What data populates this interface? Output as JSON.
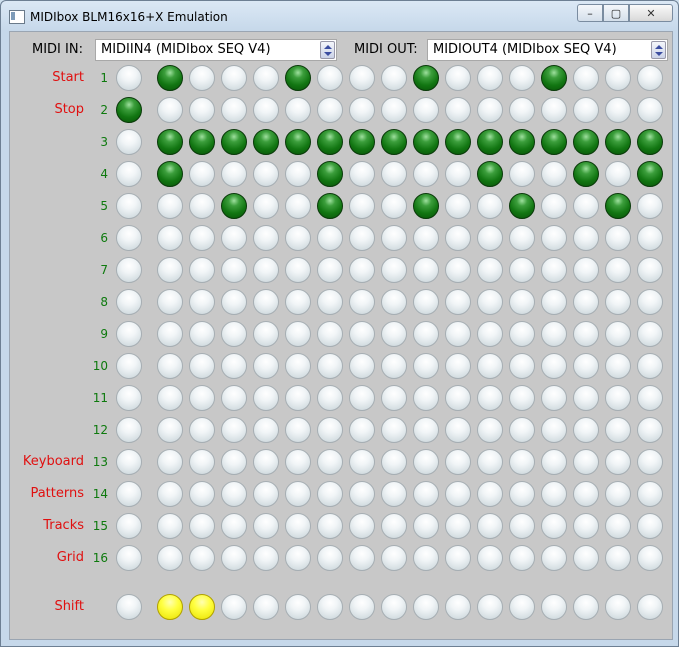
{
  "window": {
    "title": "MIDIbox BLM16x16+X Emulation",
    "min_glyph": "–",
    "max_glyph": "▢",
    "close_glyph": "✕"
  },
  "midi_in": {
    "label": "MIDI IN:",
    "value": "MIDIIN4 (MIDIbox SEQ V4)"
  },
  "midi_out": {
    "label": "MIDI OUT:",
    "value": "MIDIOUT4 (MIDIbox SEQ V4)"
  },
  "rows": [
    {
      "label": "Start",
      "num": "1"
    },
    {
      "label": "Stop",
      "num": "2"
    },
    {
      "label": "",
      "num": "3"
    },
    {
      "label": "",
      "num": "4"
    },
    {
      "label": "",
      "num": "5"
    },
    {
      "label": "",
      "num": "6"
    },
    {
      "label": "",
      "num": "7"
    },
    {
      "label": "",
      "num": "8"
    },
    {
      "label": "",
      "num": "9"
    },
    {
      "label": "",
      "num": "10"
    },
    {
      "label": "",
      "num": "11"
    },
    {
      "label": "",
      "num": "12"
    },
    {
      "label": "Keyboard",
      "num": "13"
    },
    {
      "label": "Patterns",
      "num": "14"
    },
    {
      "label": "Tracks",
      "num": "15"
    },
    {
      "label": "Grid",
      "num": "16"
    }
  ],
  "shift_row": {
    "label": "Shift",
    "num": ""
  },
  "colors": {
    "led_on": "#127612",
    "shift_on": "#ffff40",
    "label": "#e01010",
    "number": "#0e7a0e"
  },
  "extra_column_on": [
    false,
    true,
    false,
    false,
    false,
    false,
    false,
    false,
    false,
    false,
    false,
    false,
    false,
    false,
    false,
    false
  ],
  "grid_on": [
    [
      1,
      0,
      0,
      0,
      1,
      0,
      0,
      0,
      1,
      0,
      0,
      0,
      1,
      0,
      0,
      0
    ],
    [
      0,
      0,
      0,
      0,
      0,
      0,
      0,
      0,
      0,
      0,
      0,
      0,
      0,
      0,
      0,
      0
    ],
    [
      1,
      1,
      1,
      1,
      1,
      1,
      1,
      1,
      1,
      1,
      1,
      1,
      1,
      1,
      1,
      1
    ],
    [
      1,
      0,
      0,
      0,
      0,
      1,
      0,
      0,
      0,
      0,
      1,
      0,
      0,
      1,
      0,
      1
    ],
    [
      0,
      0,
      1,
      0,
      0,
      1,
      0,
      0,
      1,
      0,
      0,
      1,
      0,
      0,
      1,
      0
    ],
    [
      0,
      0,
      0,
      0,
      0,
      0,
      0,
      0,
      0,
      0,
      0,
      0,
      0,
      0,
      0,
      0
    ],
    [
      0,
      0,
      0,
      0,
      0,
      0,
      0,
      0,
      0,
      0,
      0,
      0,
      0,
      0,
      0,
      0
    ],
    [
      0,
      0,
      0,
      0,
      0,
      0,
      0,
      0,
      0,
      0,
      0,
      0,
      0,
      0,
      0,
      0
    ],
    [
      0,
      0,
      0,
      0,
      0,
      0,
      0,
      0,
      0,
      0,
      0,
      0,
      0,
      0,
      0,
      0
    ],
    [
      0,
      0,
      0,
      0,
      0,
      0,
      0,
      0,
      0,
      0,
      0,
      0,
      0,
      0,
      0,
      0
    ],
    [
      0,
      0,
      0,
      0,
      0,
      0,
      0,
      0,
      0,
      0,
      0,
      0,
      0,
      0,
      0,
      0
    ],
    [
      0,
      0,
      0,
      0,
      0,
      0,
      0,
      0,
      0,
      0,
      0,
      0,
      0,
      0,
      0,
      0
    ],
    [
      0,
      0,
      0,
      0,
      0,
      0,
      0,
      0,
      0,
      0,
      0,
      0,
      0,
      0,
      0,
      0
    ],
    [
      0,
      0,
      0,
      0,
      0,
      0,
      0,
      0,
      0,
      0,
      0,
      0,
      0,
      0,
      0,
      0
    ],
    [
      0,
      0,
      0,
      0,
      0,
      0,
      0,
      0,
      0,
      0,
      0,
      0,
      0,
      0,
      0,
      0
    ],
    [
      0,
      0,
      0,
      0,
      0,
      0,
      0,
      0,
      0,
      0,
      0,
      0,
      0,
      0,
      0,
      0
    ]
  ],
  "shift_extra_on": false,
  "shift_buttons_on": [
    1,
    1,
    0,
    0,
    0,
    0,
    0,
    0,
    0,
    0,
    0,
    0,
    0,
    0,
    0,
    0
  ]
}
